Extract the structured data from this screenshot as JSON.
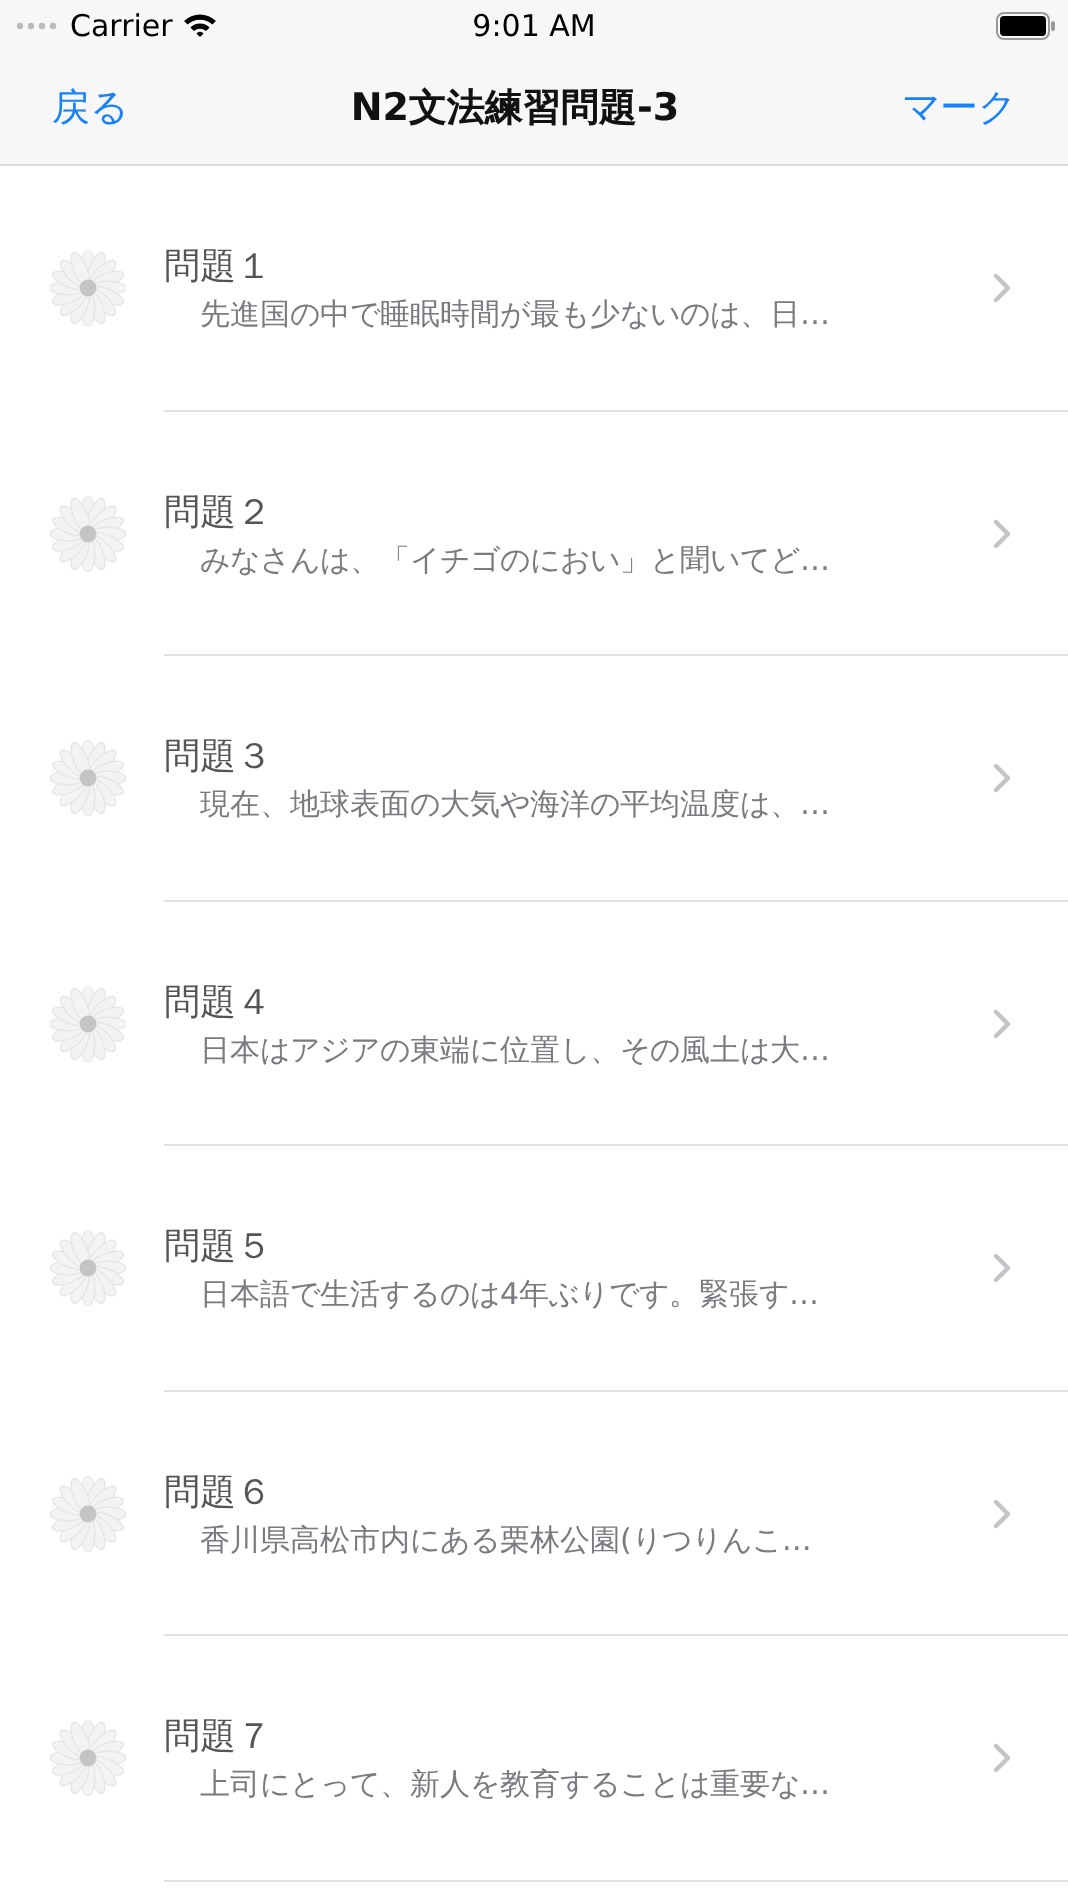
{
  "status_bar": {
    "carrier": "Carrier",
    "time": "9:01 AM"
  },
  "nav": {
    "back": "戻る",
    "title": "N2文法練習問題-3",
    "action": "マーク"
  },
  "items": [
    {
      "title": "問題１",
      "subtitle": "先進国の中で睡眠時間が最も少ないのは、日…"
    },
    {
      "title": "問題２",
      "subtitle": "みなさんは、「イチゴのにおい」と聞いてど…"
    },
    {
      "title": "問題３",
      "subtitle": "現在、地球表面の大気や海洋の平均温度は、…"
    },
    {
      "title": "問題４",
      "subtitle": "日本はアジアの東端に位置し、その風土は大…"
    },
    {
      "title": "問題５",
      "subtitle": "日本語で生活するのは4年ぶりです。緊張す…"
    },
    {
      "title": "問題６",
      "subtitle": "香川県高松市内にある栗林公園(りつりんこ…"
    },
    {
      "title": "問題７",
      "subtitle": "上司にとって、新人を教育することは重要な…"
    }
  ]
}
